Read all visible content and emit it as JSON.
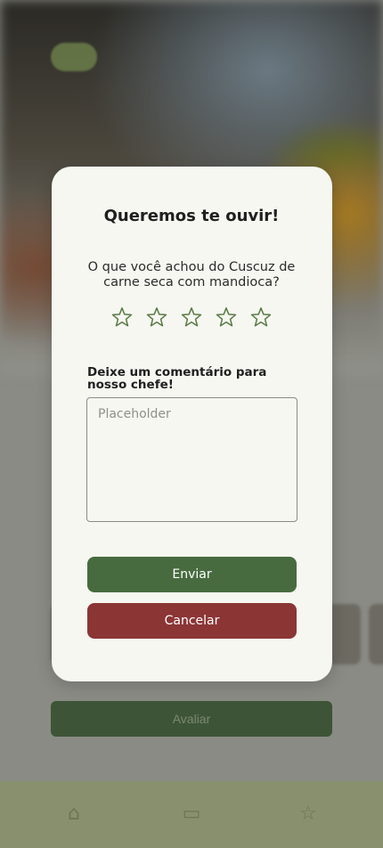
{
  "background": {
    "primary_button_label": "Avaliar",
    "nav_icons": [
      "home-icon",
      "calendar-icon",
      "star-icon"
    ]
  },
  "modal": {
    "title": "Queremos te ouvir!",
    "question": "O que você achou do Cuscuz de carne seca com mandioca?",
    "rating": {
      "max": 5,
      "value": 0
    },
    "comment_label": "Deixe um comentário para nosso chefe!",
    "comment_placeholder": "Placeholder",
    "comment_value": "",
    "send_label": "Enviar",
    "cancel_label": "Cancelar"
  },
  "colors": {
    "primary": "#476b3f",
    "danger": "#8b3535",
    "modal_bg": "#f5f7f0",
    "star_outline": "#5a7a45"
  }
}
